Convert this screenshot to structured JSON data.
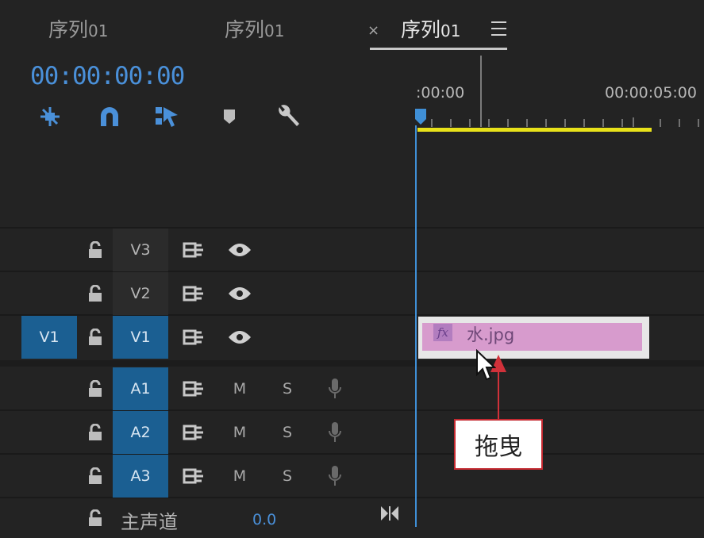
{
  "tabs": [
    {
      "name": "序列",
      "num": "01",
      "active": false
    },
    {
      "name": "序列",
      "num": "01",
      "active": false
    },
    {
      "name": "序列",
      "num": "01",
      "active": true
    }
  ],
  "tab_close": "×",
  "timecode": "00:00:00:00",
  "toolbar_icons": [
    "snap-nest-icon",
    "magnet-icon",
    "linked-selection-icon",
    "add-marker-icon",
    "wrench-icon"
  ],
  "ruler": {
    "start": ":00:00",
    "mid": "00:00:05:00"
  },
  "video_tracks": [
    {
      "source": "",
      "label": "V3",
      "targeted": false
    },
    {
      "source": "",
      "label": "V2",
      "targeted": false
    },
    {
      "source": "V1",
      "label": "V1",
      "targeted": true
    }
  ],
  "audio_tracks": [
    {
      "label": "A1",
      "m": "M",
      "s": "S"
    },
    {
      "label": "A2",
      "m": "M",
      "s": "S"
    },
    {
      "label": "A3",
      "m": "M",
      "s": "S"
    }
  ],
  "master": {
    "label": "主声道",
    "value": "0.0"
  },
  "clip": {
    "fx": "fx",
    "name": "水.jpg",
    "color": "#d79bcd"
  },
  "callout": {
    "text": "拖曳",
    "color": "#c42a31"
  },
  "colors": {
    "accent": "#3f8fd6",
    "work_area": "#e8e11a",
    "track_target": "#1b5f92"
  }
}
